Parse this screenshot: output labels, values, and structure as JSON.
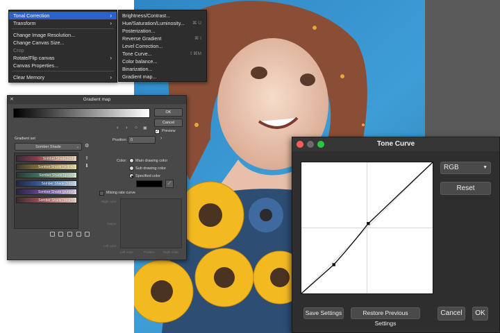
{
  "menu": {
    "items": [
      {
        "label": "Tonal Correction",
        "arrow": "›",
        "state": "active"
      },
      {
        "label": "Transform",
        "arrow": "›",
        "state": "normal"
      },
      {
        "label": "Change Image Resolution...",
        "state": "normal"
      },
      {
        "label": "Change Canvas Size...",
        "state": "normal"
      },
      {
        "label": "Crop",
        "state": "disabled"
      },
      {
        "label": "Rotate/Flip canvas",
        "arrow": "›",
        "state": "normal"
      },
      {
        "label": "Canvas Properties...",
        "state": "normal"
      },
      {
        "label": "Clear Memory",
        "arrow": "›",
        "state": "normal"
      }
    ],
    "submenu": [
      {
        "label": "Brightness/Contrast...",
        "shortcut": ""
      },
      {
        "label": "Hue/Saturation/Luminosity...",
        "shortcut": "⌘ U"
      },
      {
        "label": "Posterization...",
        "shortcut": ""
      },
      {
        "label": "Reverse Gradient",
        "shortcut": "⌘ I"
      },
      {
        "label": "Level Correction...",
        "shortcut": ""
      },
      {
        "label": "Tone Curve...",
        "shortcut": "⇧⌘M"
      },
      {
        "label": "Color balance...",
        "shortcut": ""
      },
      {
        "label": "Binarization...",
        "shortcut": ""
      },
      {
        "label": "Gradient map...",
        "shortcut": ""
      }
    ]
  },
  "gradient_map": {
    "title": "Gradient map",
    "close": "✕",
    "ok": "OK",
    "cancel": "Cancel",
    "preview": "Preview",
    "gradient_set_label": "Gradient set",
    "gradient_set_value": "Somber Shade",
    "position_label": "Position:",
    "position_value": "0",
    "color_label": "Color:",
    "color_options": [
      "Main drawing color",
      "Sub drawing color",
      "Specified color"
    ],
    "selected_color_index": 2,
    "specified_color": "#000000",
    "mixing_rate_label": "Mixing rate curve",
    "graph_labels": {
      "right": "Right color",
      "output": "Output",
      "left": "Left color",
      "left_node": "Left node",
      "position": "Position",
      "right_node": "Right node"
    },
    "gradients": [
      {
        "name": "Somber Shade (red)",
        "colors": [
          "#3a2a3a",
          "#8b3c4a",
          "#d6a28a",
          "#f2d7b8"
        ]
      },
      {
        "name": "Somber Shade (yellow)",
        "colors": [
          "#3a3a2a",
          "#7d6a3a",
          "#c9b16a",
          "#f0e0a0"
        ]
      },
      {
        "name": "Somber Shade (green)",
        "colors": [
          "#263a34",
          "#3c6b5b",
          "#8ab89a",
          "#d8ecd2"
        ]
      },
      {
        "name": "Somber Shade (blue)",
        "colors": [
          "#22283e",
          "#35508a",
          "#6f9ad0",
          "#cfe3f2"
        ]
      },
      {
        "name": "Somber Shade (purple)",
        "colors": [
          "#2c2440",
          "#5a3f86",
          "#9a7bc6",
          "#e2d4f0"
        ]
      },
      {
        "name": "Somber Shade (peach)",
        "colors": [
          "#3d2a2c",
          "#8a4a52",
          "#d8948a",
          "#f4d8cc"
        ]
      }
    ]
  },
  "tone_curve": {
    "title": "Tone Curve",
    "channel": "RGB",
    "reset": "Reset",
    "save": "Save Settings",
    "restore": "Restore Previous Settings",
    "cancel": "Cancel",
    "ok": "OK",
    "control_points": [
      {
        "input": 0,
        "output": 0
      },
      {
        "input": 63,
        "output": 56
      },
      {
        "input": 130,
        "output": 136
      },
      {
        "input": 255,
        "output": 255
      }
    ],
    "colors": {
      "close": "#ff5f57",
      "minimize": "#6b6b6b",
      "zoom": "#28c940"
    }
  }
}
